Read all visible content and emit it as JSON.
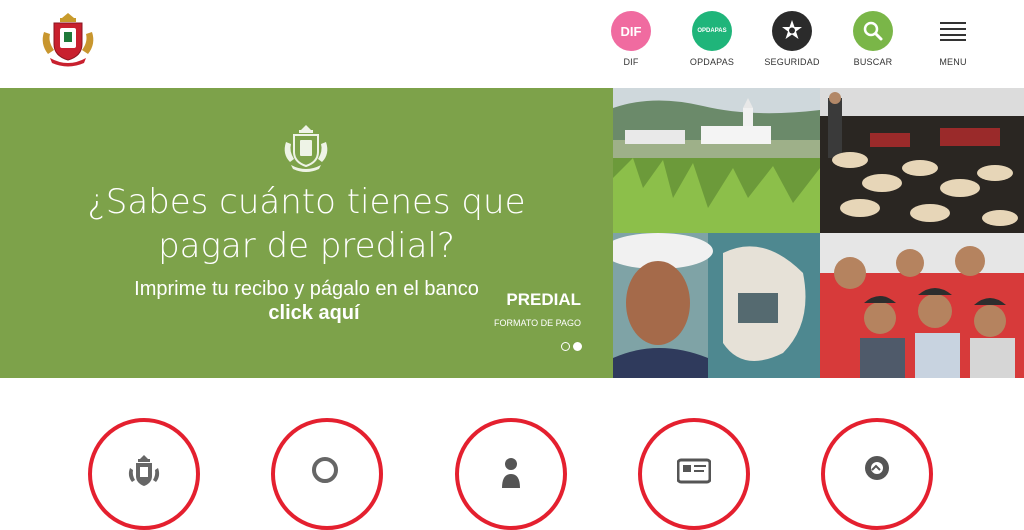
{
  "header": {
    "nav": [
      {
        "icon_text": "DIF",
        "label": "DIF",
        "color": "#f06ba0"
      },
      {
        "icon_text": "OPDAPAS",
        "label": "OPDAPAS",
        "color": "#1fb57a"
      },
      {
        "icon_text": "",
        "label": "SEGURIDAD",
        "color": "#2b2b2b"
      },
      {
        "icon_text": "",
        "label": "BUSCAR",
        "color": "#7ab648"
      },
      {
        "icon_text": "",
        "label": "MENU",
        "color": "#333333"
      }
    ]
  },
  "hero": {
    "title_line1": "¿Sabes cuánto tienes que",
    "title_line2": "pagar de predial?",
    "subtitle": "Imprime tu recibo y págalo en el banco",
    "link": "click aquí",
    "slide_title": "PREDIAL",
    "slide_subtitle": "FORMATO DE PAGO",
    "background_color": "#7da24a",
    "slide_count": 2,
    "active_slide": 2
  },
  "services": {
    "accent_color": "#e4202f",
    "items": [
      {
        "icon": "municipal-crest-icon"
      },
      {
        "icon": "search-icon"
      },
      {
        "icon": "person-icon"
      },
      {
        "icon": "id-card-icon"
      },
      {
        "icon": "map-pin-icon"
      }
    ]
  }
}
